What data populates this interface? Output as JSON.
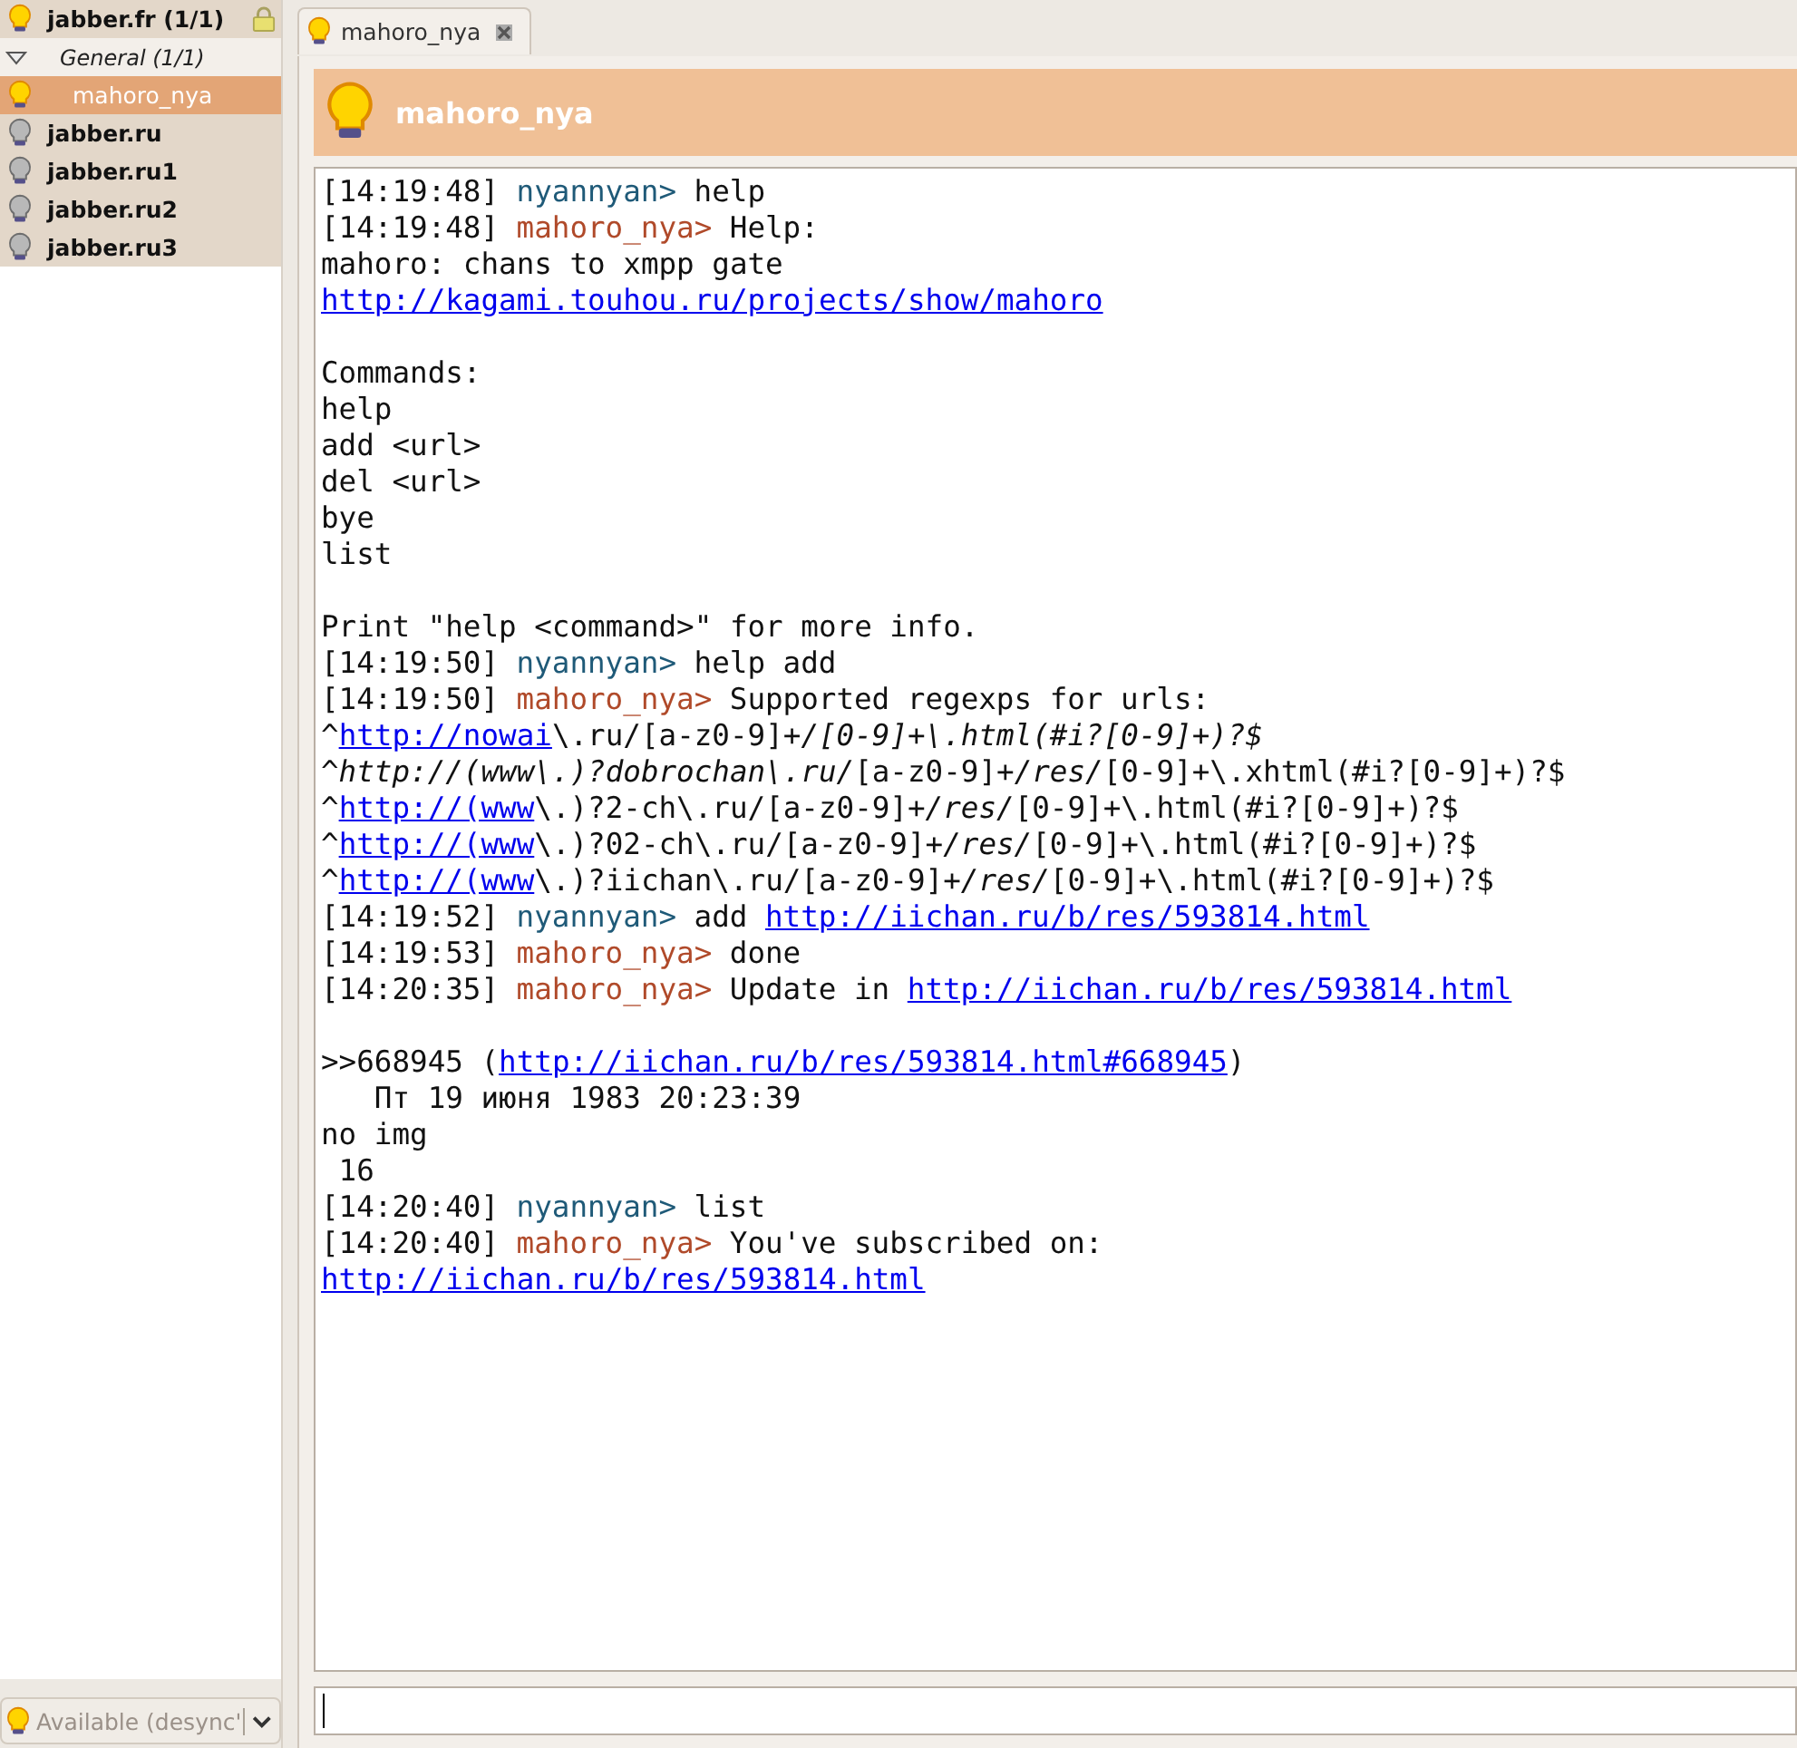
{
  "roster": [
    {
      "kind": "account",
      "name": "jabber.fr (1/1)",
      "online": true,
      "locked": true,
      "children": [
        {
          "kind": "group",
          "name": "General (1/1)",
          "expanded": true,
          "children": [
            {
              "kind": "contact",
              "name": "mahoro_nya",
              "online": true,
              "selected": true
            }
          ]
        }
      ]
    },
    {
      "kind": "account",
      "name": "jabber.ru",
      "online": false,
      "locked": false
    },
    {
      "kind": "account",
      "name": "jabber.ru1",
      "online": false,
      "locked": false
    },
    {
      "kind": "account",
      "name": "jabber.ru2",
      "online": false,
      "locked": false
    },
    {
      "kind": "account",
      "name": "jabber.ru3",
      "online": false,
      "locked": false
    }
  ],
  "status_selector": {
    "value": "Available (desync'",
    "online": true
  },
  "tabs": [
    {
      "label": "mahoro_nya",
      "selected": true
    }
  ],
  "chat_header": {
    "name": "mahoro_nya",
    "online": true
  },
  "messages": [
    {
      "kind": "line",
      "segments": [
        {
          "kind": "time",
          "text": "[14:19:48]"
        },
        {
          "kind": "other",
          "text": "nyannyan>"
        },
        {
          "kind": "text",
          "text": "help"
        }
      ]
    },
    {
      "kind": "line",
      "segments": [
        {
          "kind": "time",
          "text": "[14:19:48]"
        },
        {
          "kind": "self",
          "text": "mahoro_nya>"
        },
        {
          "kind": "text",
          "text": "Help:"
        }
      ]
    },
    {
      "kind": "line",
      "segments": [
        {
          "kind": "text",
          "text": "mahoro: chans to xmpp gate"
        }
      ]
    },
    {
      "kind": "line",
      "segments": [
        {
          "kind": "link",
          "text": "http://kagami.touhou.ru/projects/show/mahoro"
        }
      ]
    },
    {
      "kind": "blank"
    },
    {
      "kind": "line",
      "segments": [
        {
          "kind": "text",
          "text": "Commands:"
        }
      ]
    },
    {
      "kind": "line",
      "segments": [
        {
          "kind": "text",
          "text": "help"
        }
      ]
    },
    {
      "kind": "line",
      "segments": [
        {
          "kind": "text",
          "text": "add <url>"
        }
      ]
    },
    {
      "kind": "line",
      "segments": [
        {
          "kind": "text",
          "text": "del <url>"
        }
      ]
    },
    {
      "kind": "line",
      "segments": [
        {
          "kind": "text",
          "text": "bye"
        }
      ]
    },
    {
      "kind": "line",
      "segments": [
        {
          "kind": "text",
          "text": "list"
        }
      ]
    },
    {
      "kind": "blank"
    },
    {
      "kind": "line",
      "segments": [
        {
          "kind": "text",
          "text": "Print \"help <command>\" for more info."
        }
      ]
    },
    {
      "kind": "line",
      "segments": [
        {
          "kind": "time",
          "text": "[14:19:50]"
        },
        {
          "kind": "other",
          "text": "nyannyan>"
        },
        {
          "kind": "text",
          "text": "help add"
        }
      ]
    },
    {
      "kind": "line",
      "segments": [
        {
          "kind": "time",
          "text": "[14:19:50]"
        },
        {
          "kind": "self",
          "text": "mahoro_nya>"
        },
        {
          "kind": "text",
          "text": "Supported regexps for urls:"
        }
      ]
    },
    {
      "kind": "line",
      "segments": [
        {
          "kind": "tight",
          "text": "^"
        },
        {
          "kind": "link",
          "text": "http://nowai"
        },
        {
          "kind": "tight",
          "text": "\\.ru/[a-z0-9]+"
        },
        {
          "kind": "italic",
          "text": "/[0-9]+\\.html(#i?[0-9]+)?$"
        }
      ]
    },
    {
      "kind": "line",
      "segments": [
        {
          "kind": "italic",
          "text": "^http://(www\\.)?dobrochan\\.ru/"
        },
        {
          "kind": "tight",
          "text": "[a-z0-9]+"
        },
        {
          "kind": "italic",
          "text": "/res/"
        },
        {
          "kind": "tight",
          "text": "[0-9]+\\.xhtml(#i?[0-9]+)?$"
        }
      ]
    },
    {
      "kind": "line",
      "segments": [
        {
          "kind": "tight",
          "text": "^"
        },
        {
          "kind": "link",
          "text": "http://(www"
        },
        {
          "kind": "tight",
          "text": "\\.)?2-ch\\.ru/[a-z0-9]+"
        },
        {
          "kind": "italic",
          "text": "/res/"
        },
        {
          "kind": "tight",
          "text": "[0-9]+\\.html(#i?[0-9]+)?$"
        }
      ]
    },
    {
      "kind": "line",
      "segments": [
        {
          "kind": "tight",
          "text": "^"
        },
        {
          "kind": "link",
          "text": "http://(www"
        },
        {
          "kind": "tight",
          "text": "\\.)?02-ch\\.ru/[a-z0-9]+"
        },
        {
          "kind": "italic",
          "text": "/res/"
        },
        {
          "kind": "tight",
          "text": "[0-9]+\\.html(#i?[0-9]+)?$"
        }
      ]
    },
    {
      "kind": "line",
      "segments": [
        {
          "kind": "tight",
          "text": "^"
        },
        {
          "kind": "link",
          "text": "http://(www"
        },
        {
          "kind": "tight",
          "text": "\\.)?iichan\\.ru/[a-z0-9]+"
        },
        {
          "kind": "italic",
          "text": "/res/"
        },
        {
          "kind": "tight",
          "text": "[0-9]+\\.html(#i?[0-9]+)?$"
        }
      ]
    },
    {
      "kind": "line",
      "segments": [
        {
          "kind": "time",
          "text": "[14:19:52]"
        },
        {
          "kind": "other",
          "text": "nyannyan>"
        },
        {
          "kind": "text",
          "text": "add"
        },
        {
          "kind": "link",
          "text": "http://iichan.ru/b/res/593814.html"
        }
      ]
    },
    {
      "kind": "line",
      "segments": [
        {
          "kind": "time",
          "text": "[14:19:53]"
        },
        {
          "kind": "self",
          "text": "mahoro_nya>"
        },
        {
          "kind": "text",
          "text": "done"
        }
      ]
    },
    {
      "kind": "line",
      "segments": [
        {
          "kind": "time",
          "text": "[14:20:35]"
        },
        {
          "kind": "self",
          "text": "mahoro_nya>"
        },
        {
          "kind": "text",
          "text": "Update in"
        },
        {
          "kind": "link",
          "text": "http://iichan.ru/b/res/593814.html"
        }
      ]
    },
    {
      "kind": "blank"
    },
    {
      "kind": "line",
      "segments": [
        {
          "kind": "text",
          "text": ">>668945 ("
        },
        {
          "kind": "link",
          "text": "http://iichan.ru/b/res/593814.html#668945"
        },
        {
          "kind": "tight",
          "text": ")"
        }
      ]
    },
    {
      "kind": "line",
      "segments": [
        {
          "kind": "text",
          "text": "   Пт 19 июня 1983 20:23:39"
        }
      ]
    },
    {
      "kind": "line",
      "segments": [
        {
          "kind": "text",
          "text": "no img"
        }
      ]
    },
    {
      "kind": "line",
      "segments": [
        {
          "kind": "text",
          "text": " 16"
        }
      ]
    },
    {
      "kind": "line",
      "segments": [
        {
          "kind": "time",
          "text": "[14:20:40]"
        },
        {
          "kind": "other",
          "text": "nyannyan>"
        },
        {
          "kind": "text",
          "text": "list"
        }
      ]
    },
    {
      "kind": "line",
      "segments": [
        {
          "kind": "time",
          "text": "[14:20:40]"
        },
        {
          "kind": "self",
          "text": "mahoro_nya>"
        },
        {
          "kind": "text",
          "text": "You've subscribed on:"
        }
      ]
    },
    {
      "kind": "line",
      "segments": [
        {
          "kind": "link",
          "text": "http://iichan.ru/b/res/593814.html"
        }
      ]
    }
  ]
}
